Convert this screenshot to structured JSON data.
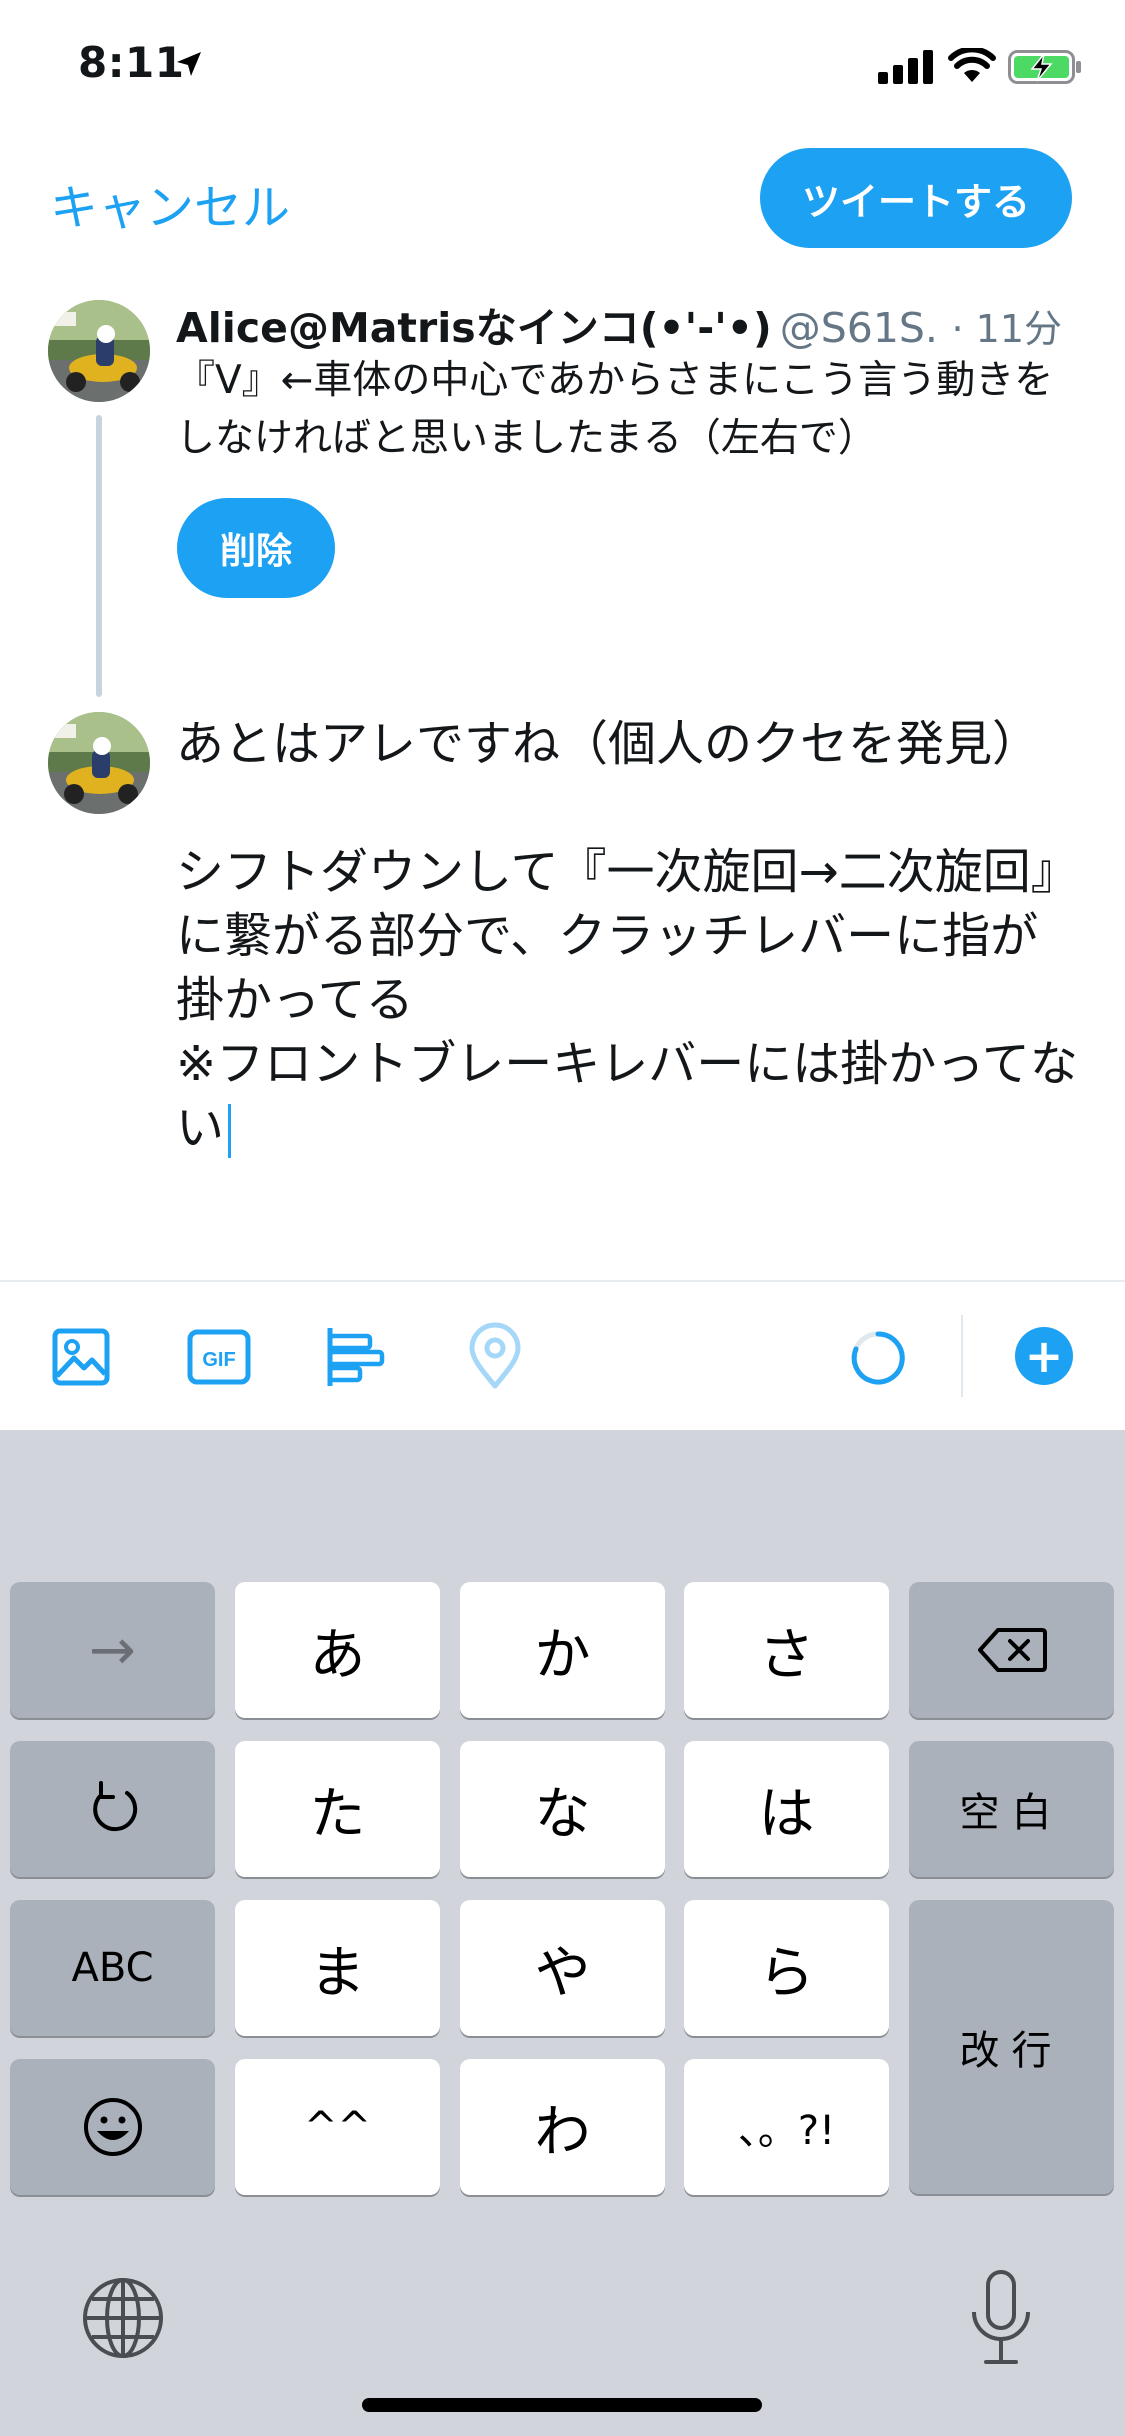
{
  "status_bar": {
    "time": "8:11"
  },
  "header": {
    "cancel_label": "キャンセル",
    "tweet_label": "ツイートする"
  },
  "thread": {
    "author_name": "Alice@Matrisなインコ(•'-'•)",
    "author_handle": "@S61S...",
    "time": "· 11分",
    "tweet_text": "『V』←車体の中心であからさまにこう言う動きをしなければと思いましたまる（左右で）",
    "delete_label": "削除"
  },
  "compose": {
    "text": "あとはアレですね（個人のクセを発見）\n\nシフトダウンして『一次旋回→二次旋回』に繋がる部分で、クラッチレバーに指が掛かってる\n※フロントブレーキレバーには掛かってない"
  },
  "toolbar": {
    "gif_label": "GIF",
    "add_label": "+",
    "icons": [
      "image-icon",
      "gif-icon",
      "poll-icon",
      "location-icon",
      "char-counter-ring",
      "plus-icon"
    ]
  },
  "keyboard": {
    "row1": [
      "→",
      "あ",
      "か",
      "さ",
      "⌫"
    ],
    "row2": [
      "↺",
      "た",
      "な",
      "は",
      "空白"
    ],
    "row3": [
      "ABC",
      "ま",
      "や",
      "ら"
    ],
    "return_label": "改行",
    "row4": [
      "☺",
      "^^",
      "わ",
      "、。?!"
    ],
    "bottom_icons": [
      "globe-icon",
      "microphone-icon"
    ]
  },
  "colors": {
    "accent": "#1da1f2",
    "keyboard_bg": "#d1d5db",
    "dark_key": "#abb1ba"
  }
}
